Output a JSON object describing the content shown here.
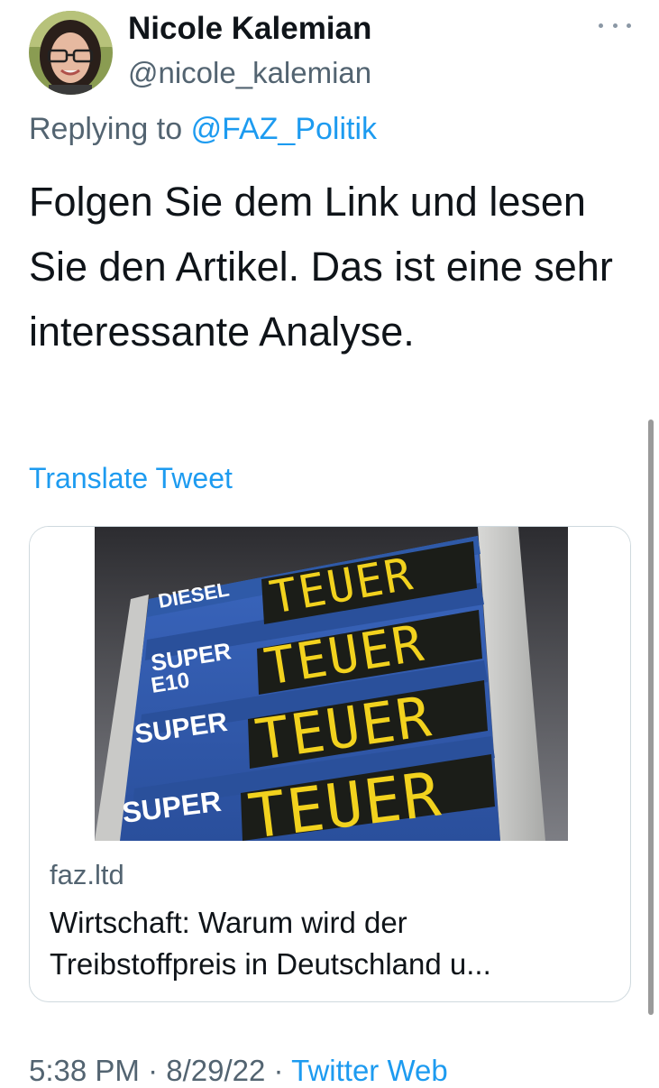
{
  "author": {
    "name": "Nicole Kalemian",
    "handle": "@nicole_kalemian"
  },
  "reply": {
    "prefix": "Replying to",
    "mention": "@FAZ_Politik"
  },
  "tweet": {
    "text": "Folgen Sie dem Link und lesen Sie den Artikel. Das ist eine sehr interessante Analyse."
  },
  "translate_label": "Translate Tweet",
  "card": {
    "image": {
      "rows": [
        {
          "label_lines": [
            "DIESEL"
          ],
          "price": "TEUER"
        },
        {
          "label_lines": [
            "SUPER",
            "E10"
          ],
          "price": "TEUER"
        },
        {
          "label_lines": [
            "SUPER"
          ],
          "price": "TEUER"
        },
        {
          "label_lines": [
            "SUPER"
          ],
          "price": "TEUER"
        }
      ]
    },
    "domain": "faz.ltd",
    "title_line1": "Wirtschaft: Warum wird der",
    "title_line2": "Treibstoffpreis in Deutschland u..."
  },
  "meta": {
    "time": "5:38 PM",
    "date": "8/29/22",
    "separator": "·",
    "source": "Twitter Web"
  },
  "colors": {
    "accent": "#1d9bf0",
    "secondary_text": "#536471",
    "sign_blue": "#2b54a8",
    "lcd_yellow": "#f2d21e"
  },
  "icons": {
    "more": "more-horizontal-icon"
  }
}
